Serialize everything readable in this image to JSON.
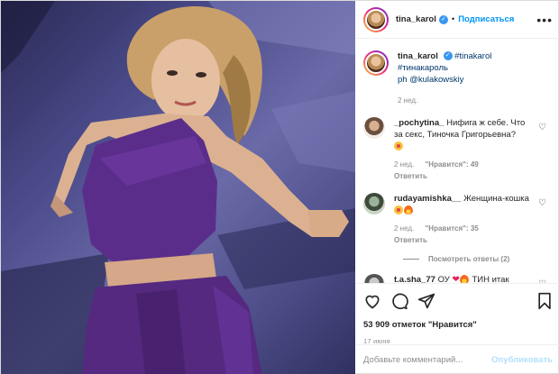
{
  "header": {
    "username": "tina_karol",
    "separator": "•",
    "follow_label": "Подписаться",
    "more_label": "•••"
  },
  "caption": {
    "username": "tina_karol",
    "text_tags": "#tinakarol #тинакароль",
    "text_ph": "ph @kulakowskiy",
    "time": "2 нед."
  },
  "comments": [
    {
      "username": "_pochytina_",
      "text": "Нифига ж себе. Что за секс, Тиночка Григорьевна?",
      "emoji": "star",
      "time": "2 нед.",
      "likes": "\"Нравится\": 49",
      "reply": "Ответить"
    },
    {
      "username": "rudayamishka__",
      "text": "Женщина-кошка",
      "emoji": "fire",
      "time": "2 нед.",
      "likes": "\"Нравится\": 35",
      "reply": "Ответить"
    },
    {
      "username": "t.a.sha_77",
      "text_a": "ОУ",
      "text_b": "ТИН итак жарко, а ты градусов",
      "emoji": "heart",
      "time": "",
      "likes": "",
      "reply": ""
    }
  ],
  "view_replies": "Посмотреть ответы (2)",
  "likes_text": "53 909 отметок \"Нравится\"",
  "date": "17 июня",
  "add_comment": {
    "placeholder": "Добавьте комментарий...",
    "publish_label": "Опубликовать"
  },
  "colors": {
    "accent": "#0095f6",
    "dress": "#5b2d8a",
    "floor": "#5656a0"
  },
  "icons": [
    "heart-icon",
    "comment-icon",
    "share-icon",
    "bookmark-icon",
    "verified-icon",
    "more-icon"
  ]
}
